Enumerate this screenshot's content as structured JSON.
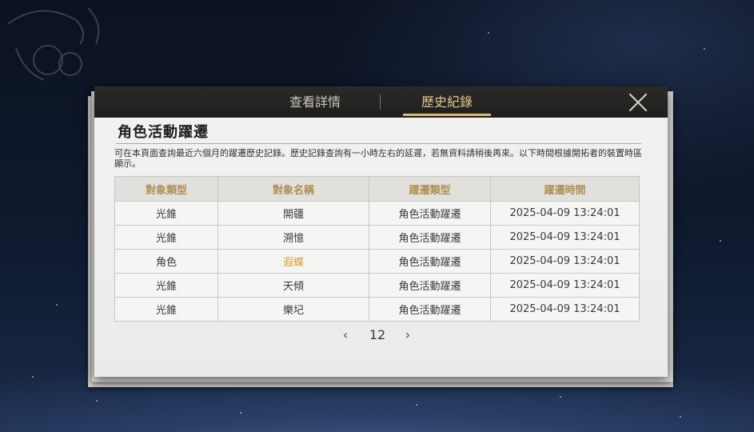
{
  "tabs": [
    {
      "label": "查看詳情",
      "active": false
    },
    {
      "label": "歷史紀錄",
      "active": true
    }
  ],
  "close_icon": "close-icon",
  "section": {
    "title": "角色活動躍遷",
    "description": "可在本頁面查詢最近六個月的躍遷歷史記錄。歷史記錄查詢有一小時左右的延遲，若無資料請稍後再來。以下時間根據開拓者的裝置時區顯示。"
  },
  "table": {
    "headers": [
      "對象類型",
      "對象名稱",
      "躍遷類型",
      "躍遷時間"
    ],
    "rows": [
      [
        "光錐",
        "開疆",
        "角色活動躍遷",
        "2025-04-09 13:24:01"
      ],
      [
        "光錐",
        "溯憶",
        "角色活動躍遷",
        "2025-04-09 13:24:01"
      ],
      [
        "角色",
        "遐蝶",
        "角色活動躍遷",
        "2025-04-09 13:24:01"
      ],
      [
        "光錐",
        "天傾",
        "角色活動躍遷",
        "2025-04-09 13:24:01"
      ],
      [
        "光錐",
        "樂圮",
        "角色活動躍遷",
        "2025-04-09 13:24:01"
      ]
    ]
  },
  "pager": {
    "prev": "‹",
    "page": "12",
    "next": "›"
  },
  "colors": {
    "header_text": "#b08e55",
    "highlight_name": "#d59a3a",
    "active_tab": "#e2c892"
  }
}
